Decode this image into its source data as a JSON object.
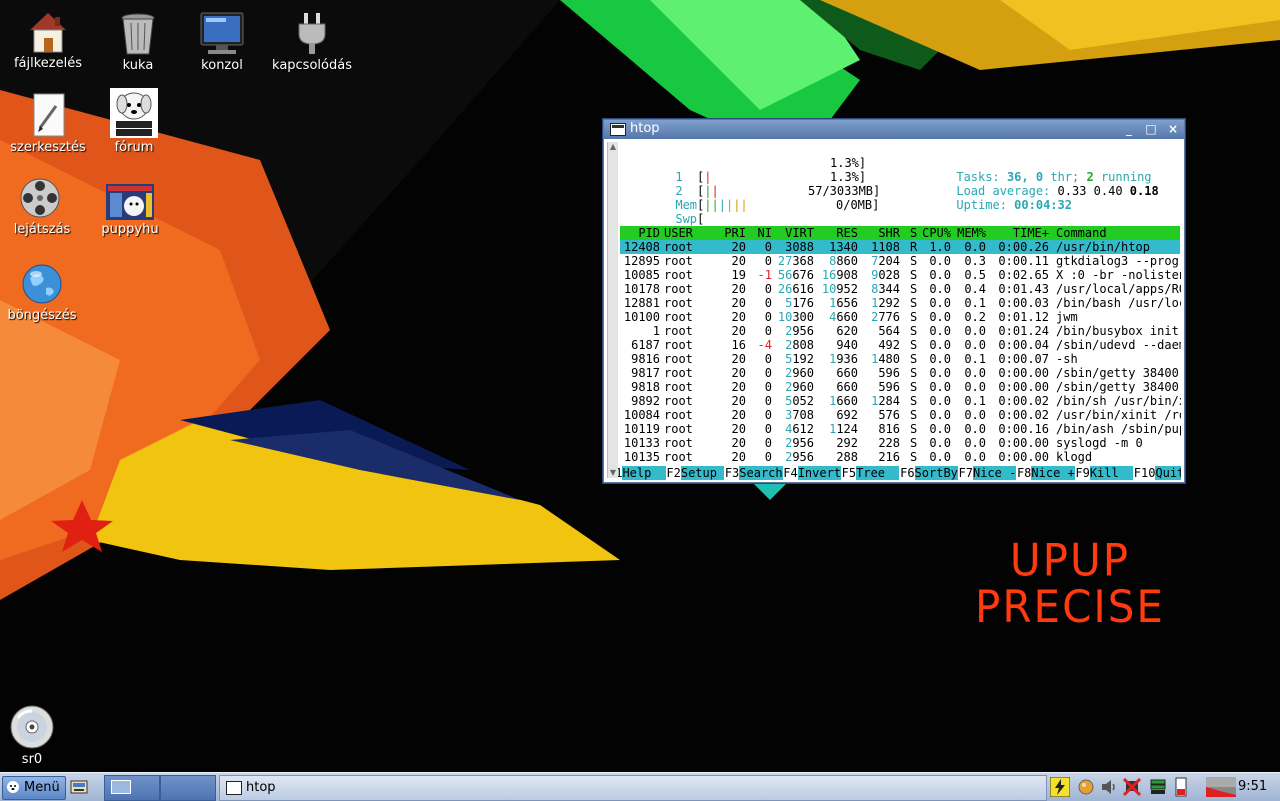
{
  "desktop": {
    "icons": [
      {
        "label": "fájlkezelés"
      },
      {
        "label": "kuka"
      },
      {
        "label": "konzol"
      },
      {
        "label": "kapcsolódás"
      },
      {
        "label": "szerkesztés"
      },
      {
        "label": "fórum"
      },
      {
        "label": "lejátszás"
      },
      {
        "label": "puppyhu"
      },
      {
        "label": "böngészés"
      },
      {
        "label": "sr0"
      }
    ],
    "brand_line1": "UPUP",
    "brand_line2": "PRECISE"
  },
  "window": {
    "title": "htop",
    "minimize": "_",
    "maximize": "□",
    "close": "×"
  },
  "htop": {
    "cpu1_label": "1",
    "cpu1_value": "1.3%]",
    "cpu2_label": "2",
    "cpu2_value": "1.3%]",
    "mem_label": "Mem",
    "mem_value": "57/3033MB]",
    "swp_label": "Swp",
    "swp_value": "0/0MB]",
    "tasks_label": "Tasks:",
    "tasks_count": "36,",
    "threads": "0",
    "threads_label": "thr;",
    "running_count": "2",
    "running_label": "running",
    "load_label": "Load average:",
    "load1": "0.33",
    "load5": "0.40",
    "load15": "0.18",
    "uptime_label": "Uptime:",
    "uptime_value": "00:04:32",
    "columns": [
      "PID",
      "USER",
      "PRI",
      "NI",
      "VIRT",
      "RES",
      "SHR",
      "S",
      "CPU%",
      "MEM%",
      "TIME+",
      "Command"
    ],
    "processes": [
      {
        "pid": "12408",
        "user": "root",
        "pri": "20",
        "ni": "0",
        "virt": "3088",
        "res": "1340",
        "shr": "1108",
        "s": "R",
        "cpu": "1.0",
        "mem": "0.0",
        "time": "0:00.26",
        "cmd": "/usr/bin/htop"
      },
      {
        "pid": "12895",
        "user": "root",
        "pri": "20",
        "ni": "0",
        "virt": "27368",
        "res": "8860",
        "shr": "7204",
        "s": "S",
        "cpu": "0.0",
        "mem": "0.3",
        "time": "0:00.11",
        "cmd": "gtkdialog3 --progr"
      },
      {
        "pid": "10085",
        "user": "root",
        "pri": "19",
        "ni": "-1",
        "virt": "56676",
        "res": "16908",
        "shr": "9028",
        "s": "S",
        "cpu": "0.0",
        "mem": "0.5",
        "time": "0:02.65",
        "cmd": "X :0 -br -nolisten"
      },
      {
        "pid": "10178",
        "user": "root",
        "pri": "20",
        "ni": "0",
        "virt": "26616",
        "res": "10952",
        "shr": "8344",
        "s": "S",
        "cpu": "0.0",
        "mem": "0.4",
        "time": "0:01.43",
        "cmd": "/usr/local/apps/RO"
      },
      {
        "pid": "12881",
        "user": "root",
        "pri": "20",
        "ni": "0",
        "virt": "5176",
        "res": "1656",
        "shr": "1292",
        "s": "S",
        "cpu": "0.0",
        "mem": "0.1",
        "time": "0:00.03",
        "cmd": "/bin/bash /usr/loc"
      },
      {
        "pid": "10100",
        "user": "root",
        "pri": "20",
        "ni": "0",
        "virt": "10300",
        "res": "4660",
        "shr": "2776",
        "s": "S",
        "cpu": "0.0",
        "mem": "0.2",
        "time": "0:01.12",
        "cmd": "jwm"
      },
      {
        "pid": "1",
        "user": "root",
        "pri": "20",
        "ni": "0",
        "virt": "2956",
        "res": "620",
        "shr": "564",
        "s": "S",
        "cpu": "0.0",
        "mem": "0.0",
        "time": "0:01.24",
        "cmd": "/bin/busybox init"
      },
      {
        "pid": "6187",
        "user": "root",
        "pri": "16",
        "ni": "-4",
        "virt": "2808",
        "res": "940",
        "shr": "492",
        "s": "S",
        "cpu": "0.0",
        "mem": "0.0",
        "time": "0:00.04",
        "cmd": "/sbin/udevd --daem"
      },
      {
        "pid": "9816",
        "user": "root",
        "pri": "20",
        "ni": "0",
        "virt": "5192",
        "res": "1936",
        "shr": "1480",
        "s": "S",
        "cpu": "0.0",
        "mem": "0.1",
        "time": "0:00.07",
        "cmd": "-sh"
      },
      {
        "pid": "9817",
        "user": "root",
        "pri": "20",
        "ni": "0",
        "virt": "2960",
        "res": "660",
        "shr": "596",
        "s": "S",
        "cpu": "0.0",
        "mem": "0.0",
        "time": "0:00.00",
        "cmd": "/sbin/getty 38400"
      },
      {
        "pid": "9818",
        "user": "root",
        "pri": "20",
        "ni": "0",
        "virt": "2960",
        "res": "660",
        "shr": "596",
        "s": "S",
        "cpu": "0.0",
        "mem": "0.0",
        "time": "0:00.00",
        "cmd": "/sbin/getty 38400"
      },
      {
        "pid": "9892",
        "user": "root",
        "pri": "20",
        "ni": "0",
        "virt": "5052",
        "res": "1660",
        "shr": "1284",
        "s": "S",
        "cpu": "0.0",
        "mem": "0.1",
        "time": "0:00.02",
        "cmd": "/bin/sh /usr/bin/x"
      },
      {
        "pid": "10084",
        "user": "root",
        "pri": "20",
        "ni": "0",
        "virt": "3708",
        "res": "692",
        "shr": "576",
        "s": "S",
        "cpu": "0.0",
        "mem": "0.0",
        "time": "0:00.02",
        "cmd": "/usr/bin/xinit /ro"
      },
      {
        "pid": "10119",
        "user": "root",
        "pri": "20",
        "ni": "0",
        "virt": "4612",
        "res": "1124",
        "shr": "816",
        "s": "S",
        "cpu": "0.0",
        "mem": "0.0",
        "time": "0:00.16",
        "cmd": "/bin/ash /sbin/pup"
      },
      {
        "pid": "10133",
        "user": "root",
        "pri": "20",
        "ni": "0",
        "virt": "2956",
        "res": "292",
        "shr": "228",
        "s": "S",
        "cpu": "0.0",
        "mem": "0.0",
        "time": "0:00.00",
        "cmd": "syslogd -m 0"
      },
      {
        "pid": "10135",
        "user": "root",
        "pri": "20",
        "ni": "0",
        "virt": "2956",
        "res": "288",
        "shr": "216",
        "s": "S",
        "cpu": "0.0",
        "mem": "0.0",
        "time": "0:00.00",
        "cmd": "klogd"
      }
    ],
    "fkeys": [
      {
        "key": "F1",
        "label": "Help  "
      },
      {
        "key": "F2",
        "label": "Setup "
      },
      {
        "key": "F3",
        "label": "Search"
      },
      {
        "key": "F4",
        "label": "Invert"
      },
      {
        "key": "F5",
        "label": "Tree  "
      },
      {
        "key": "F6",
        "label": "SortBy"
      },
      {
        "key": "F7",
        "label": "Nice -"
      },
      {
        "key": "F8",
        "label": "Nice +"
      },
      {
        "key": "F9",
        "label": "Kill  "
      },
      {
        "key": "F10",
        "label": "Quit  "
      }
    ]
  },
  "taskbar": {
    "menu_label": "Menü",
    "task_label": "htop",
    "clock": "9:51"
  }
}
